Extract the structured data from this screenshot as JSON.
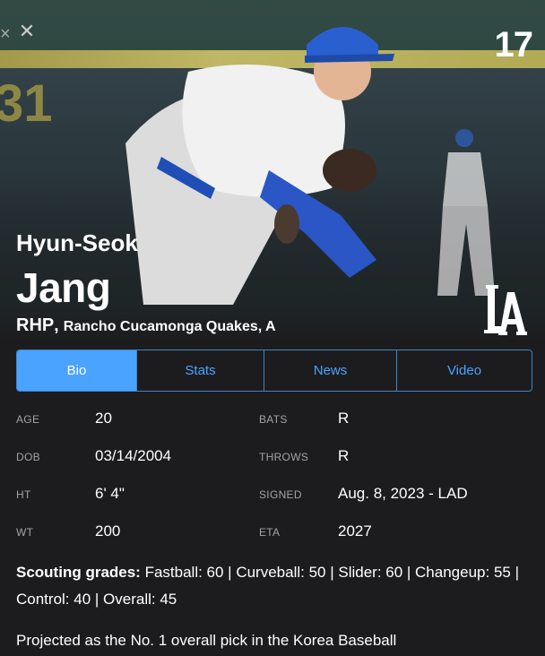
{
  "player": {
    "jersey_number": "17",
    "first_name": "Hyun-Seok",
    "last_name": "Jang",
    "position": "RHP",
    "team": "Rancho Cucamonga Quakes, A"
  },
  "tabs": [
    {
      "label": "Bio",
      "active": true
    },
    {
      "label": "Stats",
      "active": false
    },
    {
      "label": "News",
      "active": false
    },
    {
      "label": "Video",
      "active": false
    }
  ],
  "stats_left": [
    {
      "label": "AGE",
      "value": "20"
    },
    {
      "label": "DOB",
      "value": "03/14/2004"
    },
    {
      "label": "HT",
      "value": "6' 4\""
    },
    {
      "label": "WT",
      "value": "200"
    }
  ],
  "stats_right": [
    {
      "label": "BATS",
      "value": "R"
    },
    {
      "label": "THROWS",
      "value": "R"
    },
    {
      "label": "SIGNED",
      "value": "Aug. 8, 2023 - LAD"
    },
    {
      "label": "ETA",
      "value": "2027"
    }
  ],
  "scouting": {
    "heading": "Scouting grades:",
    "text": " Fastball: 60 | Curveball: 50 | Slider: 60 | Changeup: 55 | Control: 40 | Overall: 45"
  },
  "bio_text": "Projected as the No. 1 overall pick in the Korea Baseball",
  "colors": {
    "accent": "#4aa3ff",
    "background": "#1c1c1e",
    "label_gray": "#a3a3a3"
  },
  "icons": {
    "close": "close-icon",
    "team_logo": "dodgers-la-logo"
  }
}
